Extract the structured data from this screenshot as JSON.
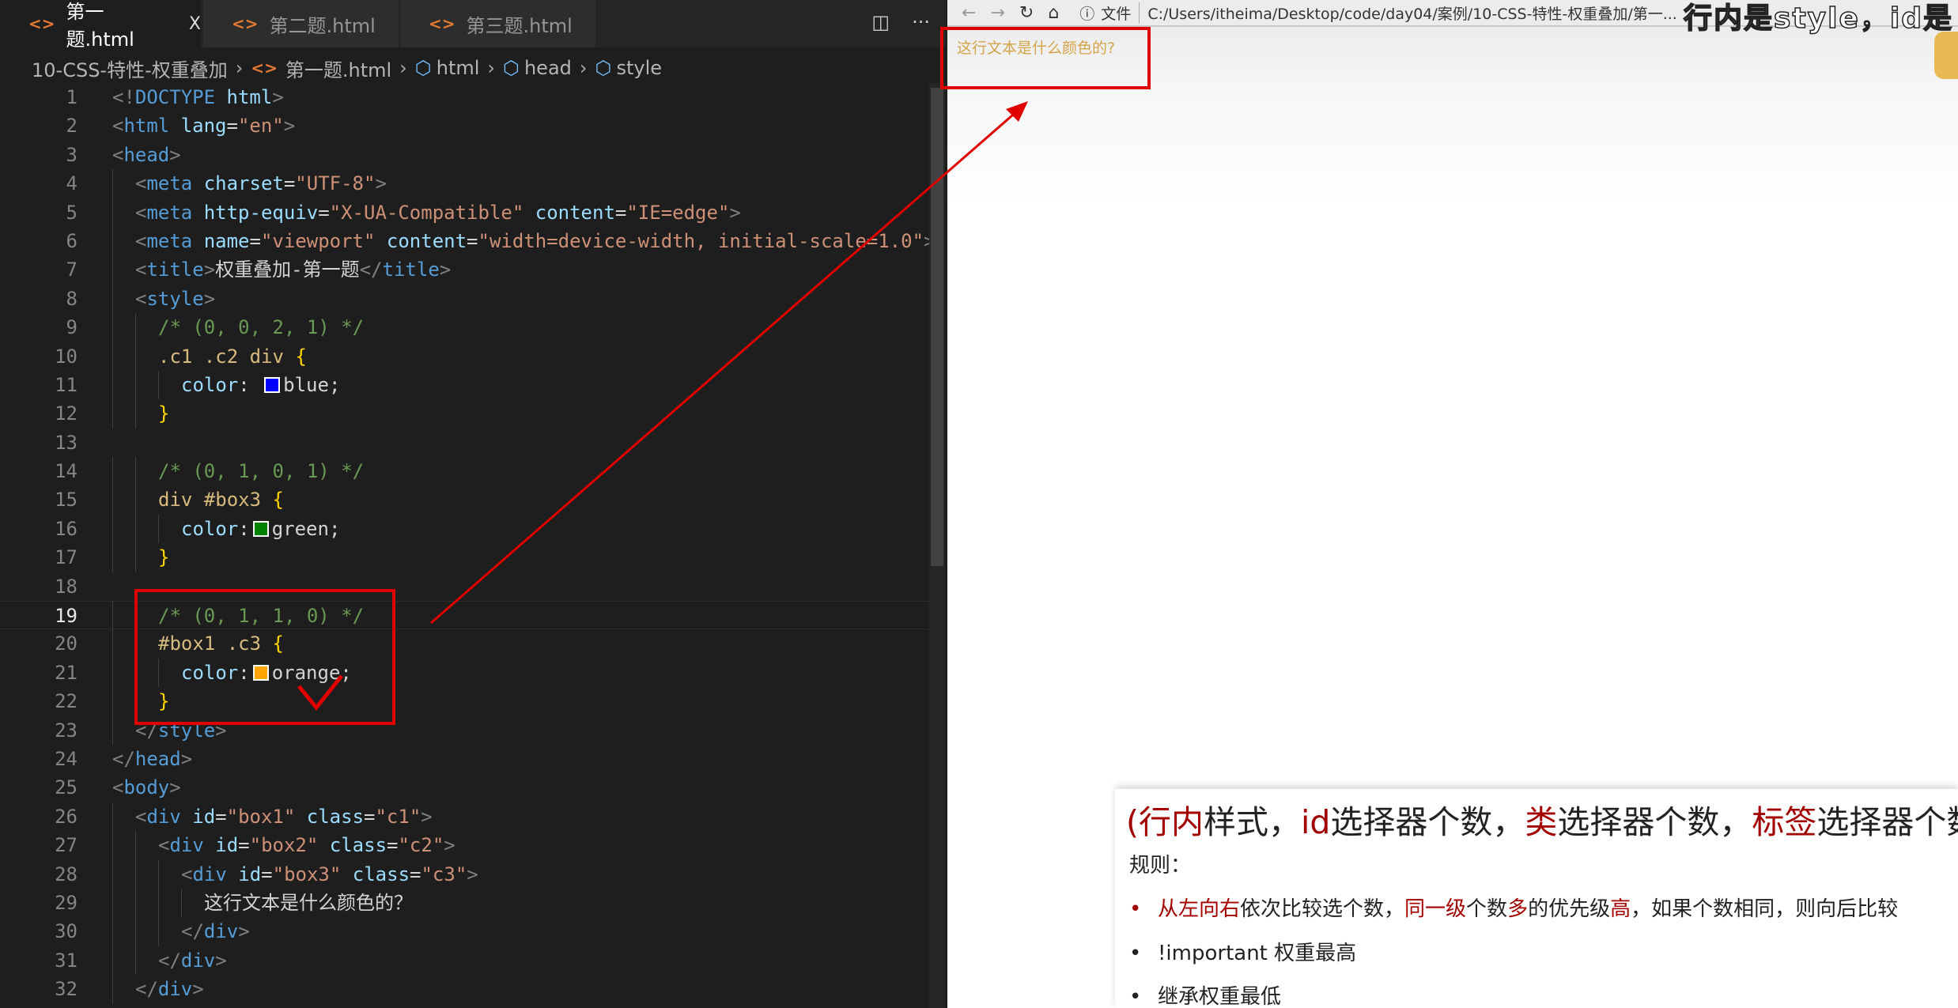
{
  "editor": {
    "tabs": [
      {
        "label": "第一题.html",
        "active": true
      },
      {
        "label": "第二题.html",
        "active": false
      },
      {
        "label": "第三题.html",
        "active": false
      }
    ],
    "close_glyph": "X",
    "breadcrumb": [
      "10-CSS-特性-权重叠加",
      "第一题.html",
      "html",
      "head",
      "style"
    ],
    "current_line": 19,
    "lines": [
      {
        "n": "1",
        "i": 0,
        "tok": [
          [
            "p",
            "<!"
          ],
          [
            "t",
            "DOCTYPE"
          ],
          [
            "a",
            " html"
          ],
          [
            "p",
            ">"
          ]
        ]
      },
      {
        "n": "2",
        "i": 0,
        "tok": [
          [
            "p",
            "<"
          ],
          [
            "t",
            "html"
          ],
          [
            "a",
            " lang"
          ],
          [
            "x",
            "="
          ],
          [
            "s",
            "\"en\""
          ],
          [
            "p",
            ">"
          ]
        ]
      },
      {
        "n": "3",
        "i": 0,
        "tok": [
          [
            "p",
            "<"
          ],
          [
            "t",
            "head"
          ],
          [
            "p",
            ">"
          ]
        ]
      },
      {
        "n": "4",
        "i": 1,
        "tok": [
          [
            "p",
            "<"
          ],
          [
            "t",
            "meta"
          ],
          [
            "a",
            " charset"
          ],
          [
            "x",
            "="
          ],
          [
            "s",
            "\"UTF-8\""
          ],
          [
            "p",
            ">"
          ]
        ]
      },
      {
        "n": "5",
        "i": 1,
        "tok": [
          [
            "p",
            "<"
          ],
          [
            "t",
            "meta"
          ],
          [
            "a",
            " http-equiv"
          ],
          [
            "x",
            "="
          ],
          [
            "s",
            "\"X-UA-Compatible\""
          ],
          [
            "a",
            " content"
          ],
          [
            "x",
            "="
          ],
          [
            "s",
            "\"IE=edge\""
          ],
          [
            "p",
            ">"
          ]
        ]
      },
      {
        "n": "6",
        "i": 1,
        "tok": [
          [
            "p",
            "<"
          ],
          [
            "t",
            "meta"
          ],
          [
            "a",
            " name"
          ],
          [
            "x",
            "="
          ],
          [
            "s",
            "\"viewport\""
          ],
          [
            "a",
            " content"
          ],
          [
            "x",
            "="
          ],
          [
            "s",
            "\"width=device-width, initial-scale=1.0\""
          ],
          [
            "p",
            ">"
          ]
        ]
      },
      {
        "n": "7",
        "i": 1,
        "tok": [
          [
            "p",
            "<"
          ],
          [
            "t",
            "title"
          ],
          [
            "p",
            ">"
          ],
          [
            "txt",
            "权重叠加-第一题"
          ],
          [
            "p",
            "</"
          ],
          [
            "t",
            "title"
          ],
          [
            "p",
            ">"
          ]
        ]
      },
      {
        "n": "8",
        "i": 1,
        "tok": [
          [
            "p",
            "<"
          ],
          [
            "t",
            "style"
          ],
          [
            "p",
            ">"
          ]
        ]
      },
      {
        "n": "9",
        "i": 2,
        "tok": [
          [
            "c",
            "/* (0, 0, 2, 1) */"
          ]
        ]
      },
      {
        "n": "10",
        "i": 2,
        "tok": [
          [
            "sel",
            ".c1 .c2 div "
          ],
          [
            "b",
            "{"
          ]
        ]
      },
      {
        "n": "11",
        "i": 3,
        "tok": [
          [
            "a",
            "color"
          ],
          [
            "x",
            ": "
          ],
          [
            "sw",
            "#0000ff"
          ],
          [
            "x",
            "blue;"
          ]
        ]
      },
      {
        "n": "12",
        "i": 2,
        "tok": [
          [
            "b",
            "}"
          ]
        ]
      },
      {
        "n": "13",
        "i": 0,
        "tok": []
      },
      {
        "n": "14",
        "i": 2,
        "tok": [
          [
            "c",
            "/* (0, 1, 0, 1) */"
          ]
        ]
      },
      {
        "n": "15",
        "i": 2,
        "tok": [
          [
            "sel",
            "div #box3 "
          ],
          [
            "b",
            "{"
          ]
        ]
      },
      {
        "n": "16",
        "i": 3,
        "tok": [
          [
            "a",
            "color"
          ],
          [
            "x",
            ":"
          ],
          [
            "sw",
            "#008000"
          ],
          [
            "x",
            "green;"
          ]
        ]
      },
      {
        "n": "17",
        "i": 2,
        "tok": [
          [
            "b",
            "}"
          ]
        ]
      },
      {
        "n": "18",
        "i": 0,
        "tok": []
      },
      {
        "n": "19",
        "i": 2,
        "tok": [
          [
            "c",
            "/* (0, 1, 1, 0) */"
          ]
        ]
      },
      {
        "n": "20",
        "i": 2,
        "tok": [
          [
            "sel",
            "#box1 .c3 "
          ],
          [
            "b",
            "{"
          ]
        ]
      },
      {
        "n": "21",
        "i": 3,
        "tok": [
          [
            "a",
            "color"
          ],
          [
            "x",
            ":"
          ],
          [
            "sw",
            "#ffa500"
          ],
          [
            "x",
            "orange;"
          ]
        ]
      },
      {
        "n": "22",
        "i": 2,
        "tok": [
          [
            "b",
            "}"
          ]
        ]
      },
      {
        "n": "23",
        "i": 1,
        "tok": [
          [
            "p",
            "</"
          ],
          [
            "t",
            "style"
          ],
          [
            "p",
            ">"
          ]
        ]
      },
      {
        "n": "24",
        "i": 0,
        "tok": [
          [
            "p",
            "</"
          ],
          [
            "t",
            "head"
          ],
          [
            "p",
            ">"
          ]
        ]
      },
      {
        "n": "25",
        "i": 0,
        "tok": [
          [
            "p",
            "<"
          ],
          [
            "t",
            "body"
          ],
          [
            "p",
            ">"
          ]
        ]
      },
      {
        "n": "26",
        "i": 1,
        "tok": [
          [
            "p",
            "<"
          ],
          [
            "t",
            "div"
          ],
          [
            "a",
            " id"
          ],
          [
            "x",
            "="
          ],
          [
            "s",
            "\"box1\""
          ],
          [
            "a",
            " class"
          ],
          [
            "x",
            "="
          ],
          [
            "s",
            "\"c1\""
          ],
          [
            "p",
            ">"
          ]
        ]
      },
      {
        "n": "27",
        "i": 2,
        "tok": [
          [
            "p",
            "<"
          ],
          [
            "t",
            "div"
          ],
          [
            "a",
            " id"
          ],
          [
            "x",
            "="
          ],
          [
            "s",
            "\"box2\""
          ],
          [
            "a",
            " class"
          ],
          [
            "x",
            "="
          ],
          [
            "s",
            "\"c2\""
          ],
          [
            "p",
            ">"
          ]
        ]
      },
      {
        "n": "28",
        "i": 3,
        "tok": [
          [
            "p",
            "<"
          ],
          [
            "t",
            "div"
          ],
          [
            "a",
            " id"
          ],
          [
            "x",
            "="
          ],
          [
            "s",
            "\"box3\""
          ],
          [
            "a",
            " class"
          ],
          [
            "x",
            "="
          ],
          [
            "s",
            "\"c3\""
          ],
          [
            "p",
            ">"
          ]
        ]
      },
      {
        "n": "29",
        "i": 4,
        "tok": [
          [
            "txt",
            "这行文本是什么颜色的？"
          ]
        ]
      },
      {
        "n": "30",
        "i": 3,
        "tok": [
          [
            "p",
            "</"
          ],
          [
            "t",
            "div"
          ],
          [
            "p",
            ">"
          ]
        ]
      },
      {
        "n": "31",
        "i": 2,
        "tok": [
          [
            "p",
            "</"
          ],
          [
            "t",
            "div"
          ],
          [
            "p",
            ">"
          ]
        ]
      },
      {
        "n": "32",
        "i": 1,
        "tok": [
          [
            "p",
            "</"
          ],
          [
            "t",
            "div"
          ],
          [
            "p",
            ">"
          ]
        ]
      }
    ]
  },
  "browser": {
    "file_label": "文件",
    "url": "C:/Users/itheima/Desktop/code/day04/案例/10-CSS-特性-权重叠加/第一...",
    "page_text": "这行文本是什么颜色的?",
    "page_text_color": "#d4a44a"
  },
  "caption": "行内是style，id是",
  "slide": {
    "heading": [
      [
        "red",
        "(行内"
      ],
      [
        "n",
        "样式，"
      ],
      [
        "red",
        "id"
      ],
      [
        "n",
        "选择器个数，"
      ],
      [
        "red",
        "类"
      ],
      [
        "n",
        "选择器个数，"
      ],
      [
        "red",
        "标签"
      ],
      [
        "n",
        "选择器个数"
      ]
    ],
    "rules_label": "规则：",
    "bullets": [
      {
        "red_dot": true,
        "segs": [
          [
            "red",
            "从左向右"
          ],
          [
            "n",
            "依次比较选个数，"
          ],
          [
            "red",
            "同一级"
          ],
          [
            "n",
            "个数"
          ],
          [
            "red",
            "多"
          ],
          [
            "n",
            "的优先级"
          ],
          [
            "red",
            "高"
          ],
          [
            "n",
            "，如果个数相同，则向后比较"
          ]
        ]
      },
      {
        "red_dot": false,
        "segs": [
          [
            "n",
            "!important 权重最高"
          ]
        ]
      },
      {
        "red_dot": false,
        "segs": [
          [
            "n",
            "继承权重最低"
          ]
        ]
      }
    ],
    "accent_color": "#a30000"
  },
  "annotation_color": "#e00000"
}
